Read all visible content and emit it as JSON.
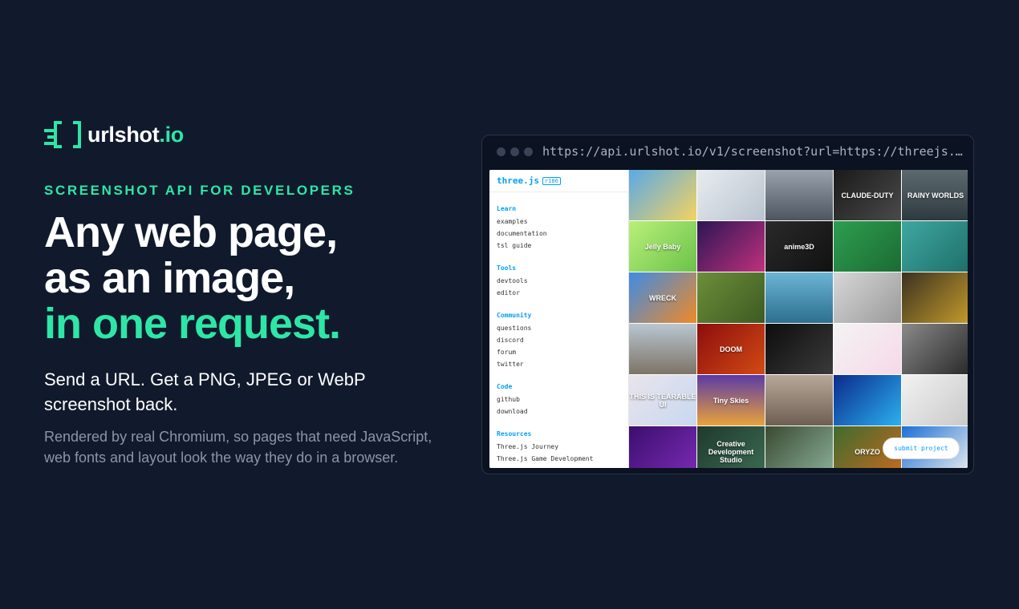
{
  "brand": {
    "name": "urlshot",
    "tld": ".io",
    "accent": "#2ee6a6",
    "background": "#111a2c"
  },
  "hero": {
    "eyebrow": "SCREENSHOT API FOR DEVELOPERS",
    "headline_1": "Any web page,",
    "headline_2": "as an image,",
    "headline_3": "in one request.",
    "subheadline": "Send a URL. Get a PNG, JPEG or WebP screenshot back.",
    "description": "Rendered by real Chromium, so pages that need JavaScript, web fonts and layout look the way they do in a browser."
  },
  "browser": {
    "url": "https://api.urlshot.io/v1/screenshot?url=https://threejs.…"
  },
  "threejs": {
    "title": "three.js",
    "revision": "r186",
    "sections": [
      {
        "title": "Learn",
        "links": [
          "examples",
          "documentation",
          "tsl guide"
        ]
      },
      {
        "title": "Tools",
        "links": [
          "devtools",
          "editor"
        ]
      },
      {
        "title": "Community",
        "links": [
          "questions",
          "discord",
          "forum",
          "twitter"
        ]
      },
      {
        "title": "Code",
        "links": [
          "github",
          "download"
        ]
      },
      {
        "title": "Resources",
        "links": [
          "Three.js Journey",
          "Three.js Game Development"
        ]
      }
    ],
    "submit_label": "submit project",
    "thumbs": [
      {
        "label": "",
        "bg": "linear-gradient(135deg,#5aa9e6,#f4d35e)"
      },
      {
        "label": "",
        "bg": "linear-gradient(135deg,#e8ecf0,#b9c4cf)"
      },
      {
        "label": "",
        "bg": "linear-gradient(180deg,#9aa3ad,#4c5560)"
      },
      {
        "label": "CLAUDE-DUTY",
        "bg": "linear-gradient(135deg,#1a1a1a,#4a4a4a)"
      },
      {
        "label": "RAINY WORLDS",
        "bg": "linear-gradient(180deg,#5c6a70,#2e3a3f)"
      },
      {
        "label": "Jelly Baby",
        "bg": "linear-gradient(135deg,#b8f07a,#6cc24a)"
      },
      {
        "label": "",
        "bg": "linear-gradient(135deg,#2b1655,#c0307d)"
      },
      {
        "label": "anime3D",
        "bg": "linear-gradient(135deg,#2a2a2a,#111111)"
      },
      {
        "label": "",
        "bg": "linear-gradient(135deg,#2e9e4f,#1b6b34)"
      },
      {
        "label": "",
        "bg": "linear-gradient(135deg,#3fa7a0,#1f6f6a)"
      },
      {
        "label": "WRECK",
        "bg": "linear-gradient(135deg,#3c8ce7,#f08a24)"
      },
      {
        "label": "",
        "bg": "linear-gradient(135deg,#6b8f3a,#3e5a22)"
      },
      {
        "label": "",
        "bg": "linear-gradient(180deg,#6bb4d6,#2d6f8e)"
      },
      {
        "label": "",
        "bg": "linear-gradient(135deg,#d7d7d7,#9a9a9a)"
      },
      {
        "label": "",
        "bg": "linear-gradient(135deg,#3a3220,#c49a2c)"
      },
      {
        "label": "",
        "bg": "linear-gradient(180deg,#b9c6d2,#7d7466)"
      },
      {
        "label": "DOOM",
        "bg": "linear-gradient(135deg,#8c0e0e,#d24a14)"
      },
      {
        "label": "",
        "bg": "linear-gradient(135deg,#0d0d0d,#3a3a3a)"
      },
      {
        "label": "",
        "bg": "linear-gradient(135deg,#f3f3f3,#f7d9e8)"
      },
      {
        "label": "",
        "bg": "linear-gradient(135deg,#8a8a8a,#2a2a2a)"
      },
      {
        "label": "THIS IS TEARABLE UI",
        "bg": "linear-gradient(135deg,#e9e4ec,#c8d8f0)"
      },
      {
        "label": "Tiny Skies",
        "bg": "linear-gradient(180deg,#5b3aa6,#e9a23b)"
      },
      {
        "label": "",
        "bg": "linear-gradient(180deg,#b7a89a,#6e5f52)"
      },
      {
        "label": "",
        "bg": "linear-gradient(135deg,#0b2a8c,#2bb0f0)"
      },
      {
        "label": "",
        "bg": "linear-gradient(135deg,#f2f2f2,#c9c9c9)"
      },
      {
        "label": "",
        "bg": "linear-gradient(135deg,#3c0e6e,#7a2bb5)"
      },
      {
        "label": "Creative Development Studio",
        "bg": "linear-gradient(135deg,#1f3a2e,#3c6b52)"
      },
      {
        "label": "",
        "bg": "linear-gradient(135deg,#3a4a30,#8cb09a)"
      },
      {
        "label": "ORYZO",
        "bg": "linear-gradient(135deg,#3e6b2f,#c76a1e)"
      },
      {
        "label": "",
        "bg": "linear-gradient(135deg,#1b6fd6,#f0f0f0)"
      }
    ]
  }
}
